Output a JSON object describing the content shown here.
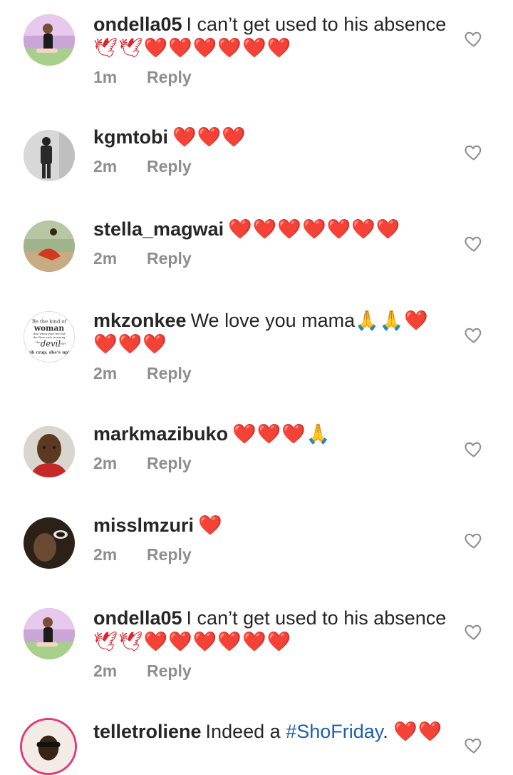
{
  "colors": {
    "text": "#262626",
    "meta": "#8e8e8e",
    "heart": "#e0202a",
    "hashtag": "#1d5fb0"
  },
  "comments": [
    {
      "username": "ondella05",
      "text": "I can’t get used to his absence",
      "emojis": "🕊🕊❤️❤️❤️❤️❤️❤️",
      "time": "1m",
      "reply": "Reply"
    },
    {
      "username": "kgmtobi",
      "text": "",
      "emojis": "❤️❤️❤️",
      "time": "2m",
      "reply": "Reply"
    },
    {
      "username": "stella_magwai",
      "text": "",
      "emojis": "❤️❤️❤️❤️❤️❤️❤️",
      "time": "2m",
      "reply": "Reply"
    },
    {
      "username": "mkzonkee",
      "text": "We love you mama",
      "emojis": "🙏🙏❤️❤️❤️❤️",
      "time": "2m",
      "reply": "Reply",
      "avatar_text": [
        "Be the kind of",
        "woman",
        "that when your feet hit",
        "the floor each morning",
        "the",
        "devil",
        "says",
        "oh crap, she's up!"
      ]
    },
    {
      "username": "markmazibuko",
      "text": "",
      "emojis": "❤️❤️❤️🙏",
      "time": "2m",
      "reply": "Reply"
    },
    {
      "username": "misslmzuri",
      "text": "",
      "emojis": "❤️",
      "time": "2m",
      "reply": "Reply"
    },
    {
      "username": "ondella05",
      "text": "I can’t get used to his absence",
      "emojis": "🕊🕊❤️❤️❤️❤️❤️❤️",
      "time": "2m",
      "reply": "Reply"
    },
    {
      "username": "telletroliene",
      "text": "Indeed a",
      "hashtag": "#ShoFriday",
      "after_hashtag": ".",
      "emojis": "❤️❤️",
      "time": "",
      "reply": ""
    }
  ],
  "icons": {
    "like": "heart-outline-icon"
  }
}
